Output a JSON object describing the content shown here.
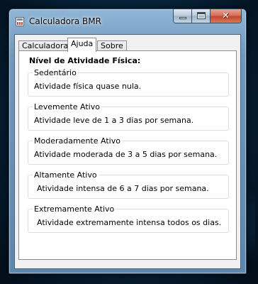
{
  "window": {
    "title": "Calculadora BMR",
    "close_glyph": "✕"
  },
  "tabs": [
    {
      "label": "Calculadora",
      "active": false
    },
    {
      "label": "Ajuda",
      "active": true
    },
    {
      "label": "Sobre",
      "active": false
    }
  ],
  "help": {
    "heading": "Nível de Atividade Física:",
    "levels": [
      {
        "title": "Sedentário",
        "description": "Atividade física quase nula."
      },
      {
        "title": "Levemente Ativo",
        "description": "Atividade leve de 1 a 3 dias por semana."
      },
      {
        "title": "Moderadamente Ativo",
        "description": "Atividade moderada de 3 a 5 dias por semana."
      },
      {
        "title": "Altamente Ativo",
        "description": "Atividade intensa de 6 a 7 dias por semana."
      },
      {
        "title": "Extremamente Ativo",
        "description": "Atividade extremamente intensa todos os dias."
      }
    ]
  },
  "icons": {
    "app": "calculator-icon",
    "minimize": "minimize-icon",
    "maximize": "maximize-icon",
    "close": "close-icon"
  },
  "colors": {
    "close_button": "#c0452b",
    "tab_border": "#898c95",
    "group_border": "#d5dfe5"
  }
}
